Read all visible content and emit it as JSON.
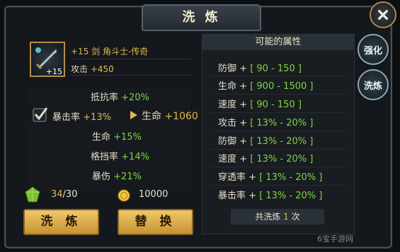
{
  "window": {
    "title": "洗 炼"
  },
  "item": {
    "level_badge": "+15",
    "name": "+15 剑 角斗士-传奇",
    "attack_label": "攻击",
    "attack_value": "+450"
  },
  "current_stats": [
    {
      "label": "抵抗率",
      "value": "+20%"
    },
    {
      "label": "暴击率",
      "value": "+13%",
      "new_label": "生命",
      "new_value": "+1060"
    },
    {
      "label": "生命",
      "value": "+15%"
    },
    {
      "label": "格挡率",
      "value": "+14%"
    },
    {
      "label": "暴伤",
      "value": "+21%"
    }
  ],
  "cost": {
    "gem_current": "34",
    "gem_total": "/30",
    "gold": "10000"
  },
  "buttons": {
    "refine": "洗 炼",
    "replace": "替 换"
  },
  "possible": {
    "title": "可能的属性",
    "attributes": [
      {
        "label": "防御",
        "plus": "+",
        "range": "[ 90 - 150 ]"
      },
      {
        "label": "生命",
        "plus": "+",
        "range": "[ 900 - 1500 ]"
      },
      {
        "label": "速度",
        "plus": "+",
        "range": "[ 90 - 150 ]"
      },
      {
        "label": "攻击",
        "plus": "+",
        "range": "[ 13% - 20% ]"
      },
      {
        "label": "防御",
        "plus": "+",
        "range": "[ 13% - 20% ]"
      },
      {
        "label": "速度",
        "plus": "+",
        "range": "[ 13% - 20% ]"
      },
      {
        "label": "穿透率",
        "plus": "+",
        "range": "[ 13% - 20% ]"
      },
      {
        "label": "暴击率",
        "plus": "+",
        "range": "[ 13% - 20% ]"
      }
    ],
    "count_prefix": "共洗炼",
    "count_value": "1",
    "count_suffix": "次"
  },
  "side_tabs": {
    "strengthen": "强化",
    "refine": "洗炼"
  },
  "watermark": "6宝手游网",
  "icons": {
    "close": "close-icon",
    "gem": "gem-icon",
    "coin": "coin-icon",
    "check": "check-icon",
    "arrow": "arrow-right-icon",
    "sword": "sword-icon"
  },
  "colors": {
    "green": "#7fd444",
    "gold": "#e3b84d",
    "button": "#e6b556"
  }
}
